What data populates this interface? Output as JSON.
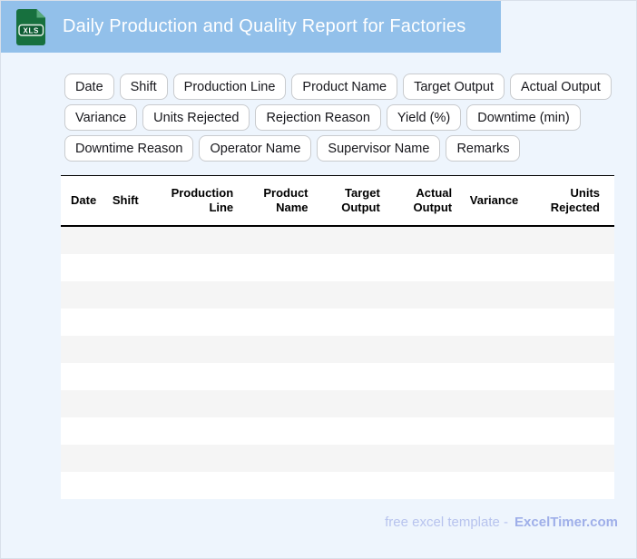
{
  "header": {
    "title": "Daily Production and Quality Report for Factories",
    "icon_label": "XLS"
  },
  "chips": {
    "rows": [
      [
        "Date",
        "Shift",
        "Production Line",
        "Product Name",
        "Target Output",
        "Actual Output"
      ],
      [
        "Variance",
        "Units Rejected",
        "Rejection Reason",
        "Yield (%)",
        "Downtime (min)"
      ],
      [
        "Downtime Reason",
        "Operator Name",
        "Supervisor Name",
        "Remarks"
      ]
    ]
  },
  "table": {
    "columns": [
      "Date",
      "Shift",
      "Production Line",
      "Product Name",
      "Target Output",
      "Actual Output",
      "Variance",
      "Units Rejected"
    ],
    "row_count": 10,
    "rows": []
  },
  "footer": {
    "text": "free excel template -",
    "brand": "ExcelTimer.com"
  },
  "colors": {
    "header_bg": "#92C0EA",
    "page_bg": "#EEF5FD",
    "canvas_border": "#D9E0EA",
    "stripe": "#F5F5F5",
    "icon_green": "#17703E",
    "icon_green_dark": "#0E5C33",
    "icon_green_light": "#57A97B",
    "footer_light": "#B7C3EE",
    "footer_brand": "#9FAFE9"
  }
}
